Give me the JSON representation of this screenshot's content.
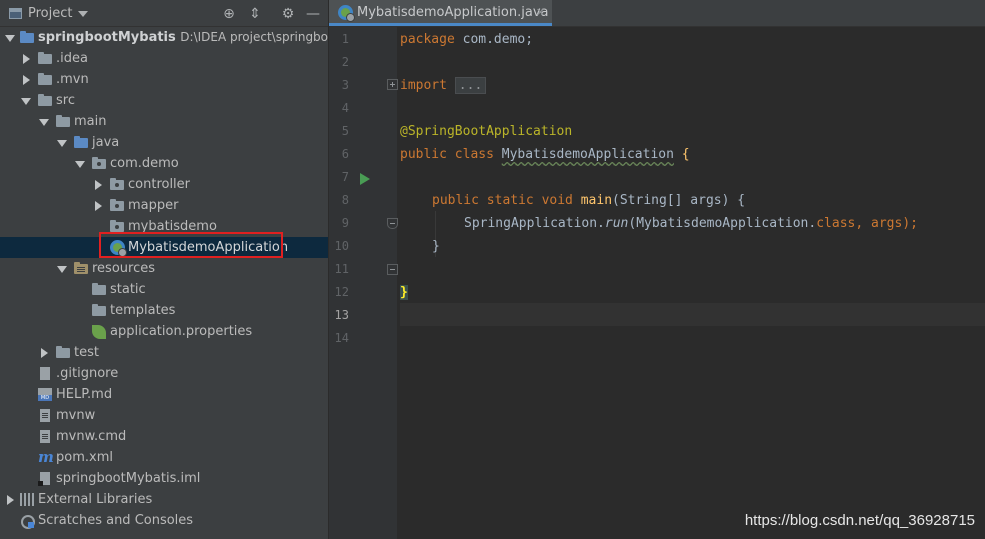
{
  "project_panel": {
    "title": "Project",
    "tree": [
      {
        "label": "springbootMybatis",
        "path": "D:\\IDEA project\\springbootMybatis"
      },
      {
        "label": ".idea"
      },
      {
        "label": ".mvn"
      },
      {
        "label": "src"
      },
      {
        "label": "main"
      },
      {
        "label": "java"
      },
      {
        "label": "com.demo"
      },
      {
        "label": "controller"
      },
      {
        "label": "mapper"
      },
      {
        "label": "mybatisdemo"
      },
      {
        "label": "MybatisdemoApplication"
      },
      {
        "label": "resources"
      },
      {
        "label": "static"
      },
      {
        "label": "templates"
      },
      {
        "label": "application.properties"
      },
      {
        "label": "test"
      },
      {
        "label": ".gitignore"
      },
      {
        "label": "HELP.md"
      },
      {
        "label": "mvnw"
      },
      {
        "label": "mvnw.cmd"
      },
      {
        "label": "pom.xml"
      },
      {
        "label": "springbootMybatis.iml"
      },
      {
        "label": "External Libraries"
      },
      {
        "label": "Scratches and Consoles"
      }
    ]
  },
  "editor": {
    "tab": {
      "label": "MybatisdemoApplication.java",
      "close": "✕"
    },
    "line_numbers": [
      "1",
      "2",
      "3",
      "4",
      "5",
      "6",
      "7",
      "8",
      "9",
      "10",
      "11",
      "12",
      "13",
      "14"
    ],
    "code": {
      "l1_kw": "package",
      "l1_rest": " com.demo;",
      "l3_kw": "import",
      "l3_dots": "...",
      "l6_ann": "@SpringBootApplication",
      "l7_kw": "public class",
      "l7_name": "MybatisdemoApplication",
      "l7_brace": "{",
      "l9_kw": "public static void",
      "l9_fn": "main",
      "l9_rest": "(String[] args) {",
      "l10_a": "SpringApplication.",
      "l10_run": "run",
      "l10_b": "(MybatisdemoApplication.",
      "l10_class": "class",
      "l10_c": ", args);",
      "l11": "}",
      "l13": "}"
    }
  },
  "watermark": "https://blog.csdn.net/qq_36928715"
}
